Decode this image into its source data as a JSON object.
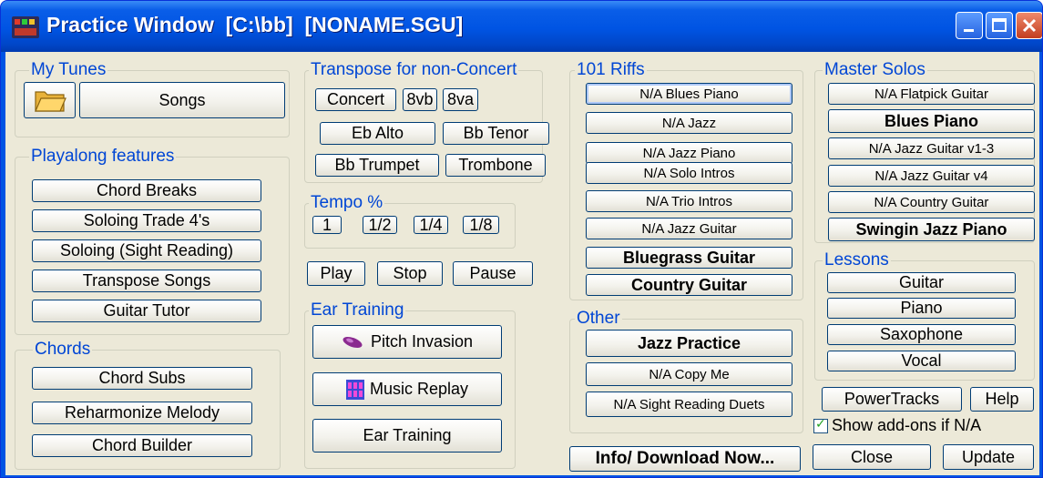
{
  "window": {
    "title": "Practice Window  [C:\\bb]  [NONAME.SGU]"
  },
  "groups": {
    "my_tunes": "My Tunes",
    "playalong": "Playalong features",
    "chords": "Chords",
    "transpose": "Transpose for non-Concert",
    "tempo": "Tempo %",
    "ear_training": "Ear Training",
    "riffs": "101 Riffs",
    "other": "Other",
    "master_solos": "Master Solos",
    "lessons": "Lessons"
  },
  "my_tunes": {
    "songs": "Songs"
  },
  "playalong": [
    "Chord Breaks",
    "Soloing Trade 4's",
    "Soloing (Sight Reading)",
    "Transpose Songs",
    "Guitar Tutor"
  ],
  "chords": [
    "Chord Subs",
    "Reharmonize Melody",
    "Chord Builder"
  ],
  "transpose": {
    "concert": "Concert",
    "8vb": "8vb",
    "8va": "8va",
    "eb_alto": "Eb Alto",
    "bb_tenor": "Bb Tenor",
    "bb_trumpet": "Bb Trumpet",
    "trombone": "Trombone"
  },
  "tempo": [
    "1",
    "1/2",
    "1/4",
    "1/8"
  ],
  "transport": {
    "play": "Play",
    "stop": "Stop",
    "pause": "Pause"
  },
  "ear_training": {
    "pitch_invasion": "Pitch Invasion",
    "music_replay": "Music Replay",
    "ear_training": "Ear Training"
  },
  "riffs": [
    "N/A Blues Piano",
    "N/A Jazz",
    "N/A Jazz Piano",
    "N/A Solo Intros",
    "N/A Trio Intros",
    "N/A Jazz Guitar",
    "Bluegrass Guitar",
    "Country Guitar"
  ],
  "other": [
    "Jazz Practice",
    "N/A Copy Me",
    "N/A Sight Reading Duets"
  ],
  "master_solos": [
    "N/A Flatpick Guitar",
    "Blues Piano",
    "N/A Jazz Guitar v1-3",
    "N/A Jazz Guitar v4",
    "N/A Country Guitar",
    "Swingin Jazz Piano"
  ],
  "lessons": [
    "Guitar",
    "Piano",
    "Saxophone",
    "Vocal"
  ],
  "bottom": {
    "powertracks": "PowerTracks",
    "help": "Help",
    "show_addons": "Show add-ons if N/A",
    "show_addons_checked": true,
    "info": "Info/ Download Now...",
    "close": "Close",
    "update": "Update"
  }
}
